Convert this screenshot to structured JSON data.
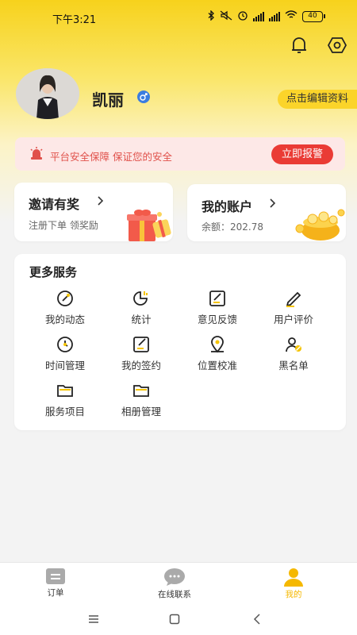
{
  "status_bar": {
    "time": "下午3:21",
    "battery": "40"
  },
  "profile": {
    "name": "凯丽",
    "edit_label": "点击编辑资料"
  },
  "safety": {
    "text": "平台安全保障 保证您的安全",
    "report_label": "立即报警"
  },
  "invite": {
    "title": "邀请有奖",
    "subtitle": "注册下单 领奖励"
  },
  "account": {
    "title": "我的账户",
    "balance_label": "余额：",
    "balance": "202.78"
  },
  "services": {
    "title": "更多服务",
    "items": [
      {
        "label": "我的动态",
        "icon": "dynamic-icon"
      },
      {
        "label": "统计",
        "icon": "stats-icon"
      },
      {
        "label": "意见反馈",
        "icon": "feedback-icon"
      },
      {
        "label": "用户评价",
        "icon": "review-icon"
      },
      {
        "label": "时间管理",
        "icon": "clock-icon"
      },
      {
        "label": "我的签约",
        "icon": "contract-icon"
      },
      {
        "label": "位置校准",
        "icon": "location-icon"
      },
      {
        "label": "黑名单",
        "icon": "blacklist-icon"
      },
      {
        "label": "服务项目",
        "icon": "folder-icon"
      },
      {
        "label": "相册管理",
        "icon": "album-icon"
      }
    ]
  },
  "bottom_nav": {
    "items": [
      {
        "label": "订单",
        "icon": "order-icon"
      },
      {
        "label": "在线联系",
        "icon": "chat-icon"
      },
      {
        "label": "我的",
        "icon": "person-icon"
      }
    ],
    "active_color": "#f5b800"
  },
  "colors": {
    "brand_yellow": "#f7d21c",
    "alert_red": "#ea3b35"
  }
}
